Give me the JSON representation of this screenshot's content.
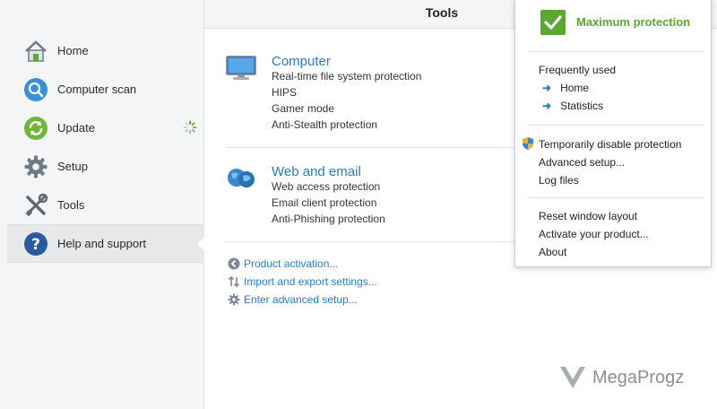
{
  "sidebar": {
    "items": [
      {
        "label": "Home",
        "icon": "home-icon"
      },
      {
        "label": "Computer scan",
        "icon": "magnifier-icon"
      },
      {
        "label": "Update",
        "icon": "refresh-icon"
      },
      {
        "label": "Setup",
        "icon": "gear-icon"
      },
      {
        "label": "Tools",
        "icon": "tools-icon"
      },
      {
        "label": "Help and support",
        "icon": "question-icon",
        "active": true
      }
    ]
  },
  "header": {
    "title": "Tools"
  },
  "sections": [
    {
      "title": "Computer",
      "icon": "monitor-icon",
      "rows": [
        {
          "label": "Real-time file system protection",
          "enabled": true
        },
        {
          "label": "HIPS",
          "enabled": true
        },
        {
          "label": "Gamer mode",
          "enabled": false
        },
        {
          "label": "Anti-Stealth protection",
          "enabled": true
        }
      ]
    },
    {
      "title": "Web and email",
      "icon": "globe-icon",
      "rows": [
        {
          "label": "Web access protection",
          "enabled": true
        },
        {
          "label": "Email client protection",
          "enabled": true
        },
        {
          "label": "Anti-Phishing protection",
          "enabled": true
        }
      ]
    }
  ],
  "links": [
    {
      "label": "Product activation...",
      "icon": "arrow-circle-icon"
    },
    {
      "label": "Import and export settings...",
      "icon": "sort-arrows-icon"
    },
    {
      "label": "Enter advanced setup...",
      "icon": "gear-icon"
    }
  ],
  "watermark": {
    "text": "MegaProgz"
  },
  "popup": {
    "status": "Maximum protection",
    "frequently_used_label": "Frequently used",
    "frequent": [
      "Home",
      "Statistics"
    ],
    "group2": [
      "Temporarily disable protection",
      "Advanced setup...",
      "Log files"
    ],
    "group3": [
      "Reset window layout",
      "Activate your product...",
      "About"
    ]
  },
  "colors": {
    "accent": "#2a7cc0",
    "green": "#5aa832",
    "sidebar_bg": "#f4f5f6"
  }
}
